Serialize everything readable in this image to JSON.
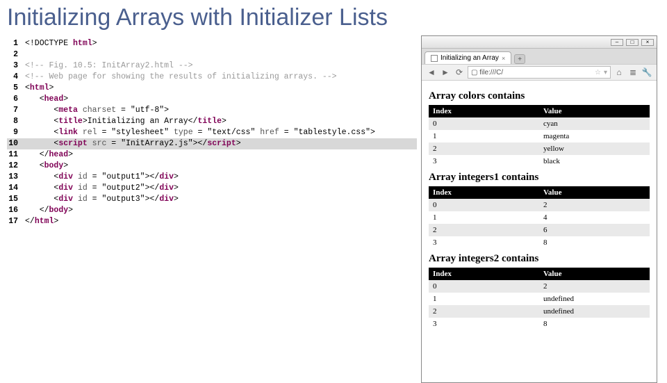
{
  "title": "Initializing Arrays with Initializer Lists",
  "code": {
    "lines": [
      {
        "n": "1",
        "hl": false,
        "html": "&lt;!DOCTYPE <span class='kw'>html</span>&gt;"
      },
      {
        "n": "2",
        "hl": false,
        "html": ""
      },
      {
        "n": "3",
        "hl": false,
        "html": "<span class='cmt'>&lt;!-- Fig. 10.5: InitArray2.html --&gt;</span>"
      },
      {
        "n": "4",
        "hl": false,
        "html": "<span class='cmt'>&lt;!-- Web page for showing the results of initializing arrays. --&gt;</span>"
      },
      {
        "n": "5",
        "hl": false,
        "html": "&lt;<span class='kw'>html</span>&gt;"
      },
      {
        "n": "6",
        "hl": false,
        "html": "   &lt;<span class='kw'>head</span>&gt;"
      },
      {
        "n": "7",
        "hl": false,
        "html": "      &lt;<span class='kw'>meta</span> <span class='attr'>charset</span> = <span class='str'>\"utf-8\"</span>&gt;"
      },
      {
        "n": "8",
        "hl": false,
        "html": "      &lt;<span class='kw'>title</span>&gt;Initializing an Array&lt;/<span class='kw'>title</span>&gt;"
      },
      {
        "n": "9",
        "hl": false,
        "html": "      &lt;<span class='kw'>link</span> <span class='attr'>rel</span> = <span class='str'>\"stylesheet\"</span> <span class='attr'>type</span> = <span class='str'>\"text/css\"</span> <span class='attr'>href</span> = <span class='str'>\"tablestyle.css\"</span>&gt;"
      },
      {
        "n": "10",
        "hl": true,
        "html": "      &lt;<span class='kw'>script</span> <span class='attr'>src</span> = <span class='str'>\"InitArray2.js\"</span>&gt;&lt;/<span class='kw'>script</span>&gt;"
      },
      {
        "n": "11",
        "hl": false,
        "html": "   &lt;/<span class='kw'>head</span>&gt;"
      },
      {
        "n": "12",
        "hl": false,
        "html": "   &lt;<span class='kw'>body</span>&gt;"
      },
      {
        "n": "13",
        "hl": false,
        "html": "      &lt;<span class='kw'>div</span> <span class='attr'>id</span> = <span class='str'>\"output1\"</span>&gt;&lt;/<span class='kw'>div</span>&gt;"
      },
      {
        "n": "14",
        "hl": false,
        "html": "      &lt;<span class='kw'>div</span> <span class='attr'>id</span> = <span class='str'>\"output2\"</span>&gt;&lt;/<span class='kw'>div</span>&gt;"
      },
      {
        "n": "15",
        "hl": false,
        "html": "      &lt;<span class='kw'>div</span> <span class='attr'>id</span> = <span class='str'>\"output3\"</span>&gt;&lt;/<span class='kw'>div</span>&gt;"
      },
      {
        "n": "16",
        "hl": false,
        "html": "   &lt;/<span class='kw'>body</span>&gt;"
      },
      {
        "n": "17",
        "hl": false,
        "html": "&lt;/<span class='kw'>html</span>&gt;"
      }
    ]
  },
  "browser": {
    "tab_title": "Initializing an Array",
    "addr_text": "file:///C/",
    "newtab_label": "+",
    "headers": {
      "index": "Index",
      "value": "Value"
    },
    "tables": [
      {
        "heading": "Array colors contains",
        "rows": [
          {
            "i": "0",
            "v": "cyan"
          },
          {
            "i": "1",
            "v": "magenta"
          },
          {
            "i": "2",
            "v": "yellow"
          },
          {
            "i": "3",
            "v": "black"
          }
        ]
      },
      {
        "heading": "Array integers1 contains",
        "rows": [
          {
            "i": "0",
            "v": "2"
          },
          {
            "i": "1",
            "v": "4"
          },
          {
            "i": "2",
            "v": "6"
          },
          {
            "i": "3",
            "v": "8"
          }
        ]
      },
      {
        "heading": "Array integers2 contains",
        "rows": [
          {
            "i": "0",
            "v": "2"
          },
          {
            "i": "1",
            "v": "undefined"
          },
          {
            "i": "2",
            "v": "undefined"
          },
          {
            "i": "3",
            "v": "8"
          }
        ]
      }
    ]
  }
}
